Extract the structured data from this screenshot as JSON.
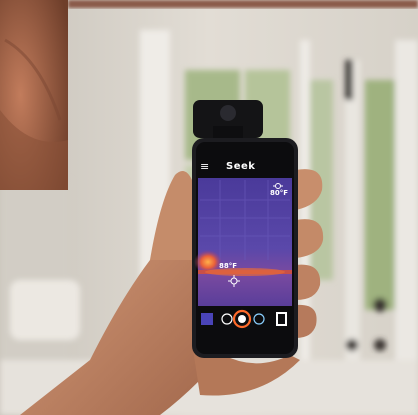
{
  "phone_screen": {
    "brand": "Seek",
    "menu_glyph": "≡",
    "temp_readout_top": "80°F",
    "temp_readout_center": "88°F",
    "thermal_palette": "iron"
  },
  "colors": {
    "wall": "#ddd8d0",
    "door": "#e8e4de",
    "window_green": "#9fb27f",
    "phone_body": "#1c1c20",
    "thermal_cold": "#4f3c9c",
    "thermal_warm": "#e0553a",
    "skin": "#c48a6a"
  }
}
